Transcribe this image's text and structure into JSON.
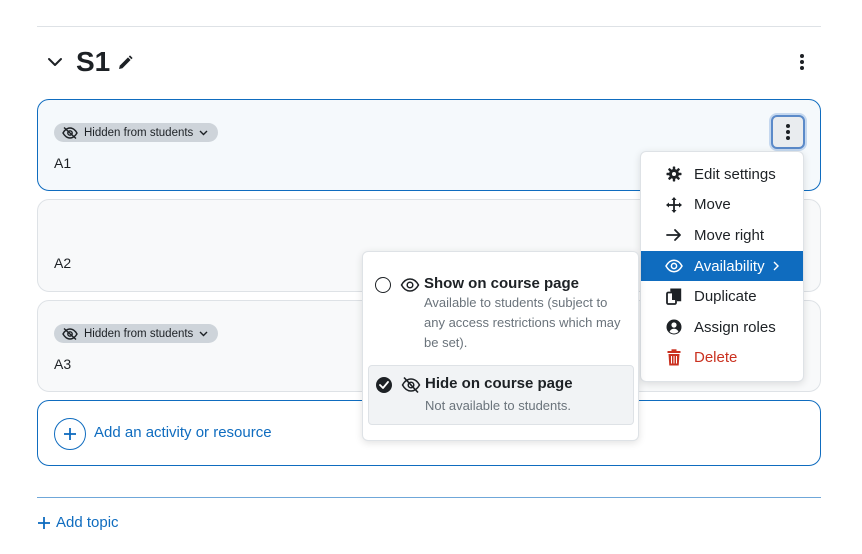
{
  "section": {
    "title": "S1"
  },
  "activities": [
    {
      "name": "A1",
      "badge": "Hidden from students"
    },
    {
      "name": "A2"
    },
    {
      "name": "A3",
      "badge": "Hidden from students"
    }
  ],
  "add_activity": {
    "label": "Add an activity or resource"
  },
  "add_topic": {
    "label": "Add topic"
  },
  "activity_menu": {
    "items": [
      {
        "label": "Edit settings",
        "icon": "gear-icon"
      },
      {
        "label": "Move",
        "icon": "move-arrows-icon"
      },
      {
        "label": "Move right",
        "icon": "arrow-right-icon"
      },
      {
        "label": "Availability",
        "icon": "eye-icon",
        "active": true
      },
      {
        "label": "Duplicate",
        "icon": "copy-icon"
      },
      {
        "label": "Assign roles",
        "icon": "user-circle-icon"
      },
      {
        "label": "Delete",
        "icon": "trash-icon",
        "danger": true
      }
    ]
  },
  "availability_menu": {
    "options": [
      {
        "title": "Show on course page",
        "description": "Available to students (subject to any access restrictions which may be set).",
        "checked": false,
        "icon": "eye-icon"
      },
      {
        "title": "Hide on course page",
        "description": "Not available to students.",
        "checked": true,
        "icon": "eye-slash-icon"
      }
    ]
  },
  "colors": {
    "primary": "#0f6cbf",
    "danger": "#ca3120",
    "badge_bg": "#ced4da",
    "text": "#1d2125",
    "muted": "#6a737b"
  }
}
